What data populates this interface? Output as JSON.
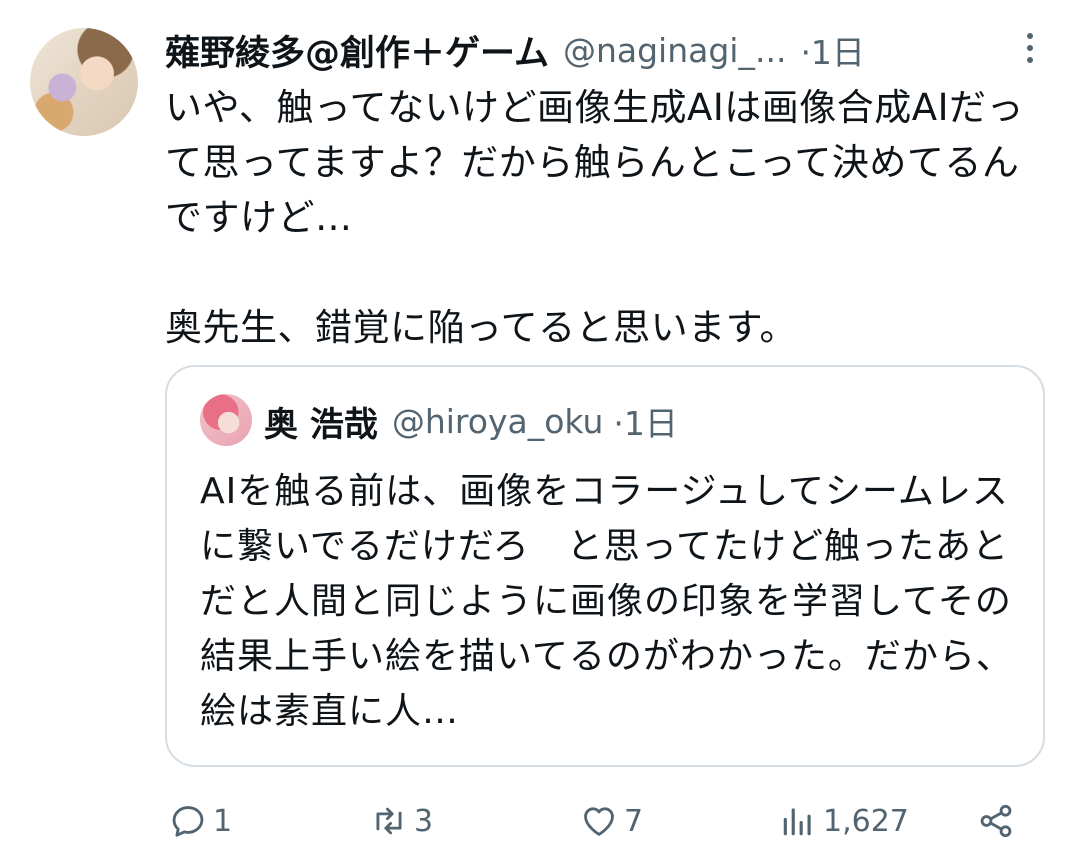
{
  "tweet": {
    "display_name": "薙野綾多@創作＋ゲーム",
    "handle": "@naginagi_...",
    "time": "·1日",
    "body": "いや、触ってないけど画像生成AIは画像合成AIだって思ってますよ？だから触らんとこって決めてるんですけど…\n\n奥先生、錯覚に陥ってると思います。"
  },
  "quote": {
    "display_name": "奥 浩哉",
    "handle": "@hiroya_oku",
    "time": "·1日",
    "body": "AIを触る前は、画像をコラージュしてシームレスに繋いでるだけだろ　と思ってたけど触ったあとだと人間と同じように画像の印象を学習してその結果上手い絵を描いてるのがわかった。だから、絵は素直に人…"
  },
  "actions": {
    "reply_count": "1",
    "retweet_count": "3",
    "like_count": "7",
    "view_count": "1,627"
  },
  "icons": {
    "more": "more-vertical-icon",
    "reply": "reply-icon",
    "retweet": "retweet-icon",
    "like": "heart-icon",
    "views": "views-chart-icon",
    "share": "share-icon"
  },
  "colors": {
    "text": "#0f1419",
    "secondary": "#536471",
    "border": "#d6dde2"
  }
}
